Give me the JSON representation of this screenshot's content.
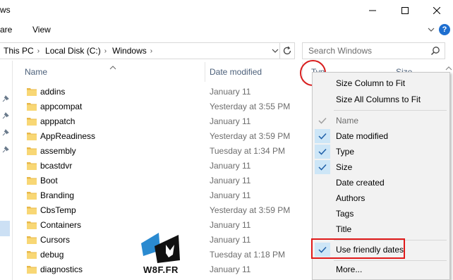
{
  "window": {
    "title": "ws",
    "minimize_icon": "minimize-icon",
    "maximize_icon": "maximize-icon",
    "close_icon": "close-icon"
  },
  "ribbon": {
    "tabs": [
      "are",
      "View"
    ]
  },
  "address": {
    "crumbs": [
      "This PC",
      "Local Disk (C:)",
      "Windows"
    ]
  },
  "search": {
    "placeholder": "Search Windows"
  },
  "columns": {
    "name": "Name",
    "date_modified": "Date modified",
    "type": "Typ",
    "size": "Size"
  },
  "files": [
    {
      "name": "addins",
      "date": "January 11"
    },
    {
      "name": "appcompat",
      "date": "Yesterday at 3:55 PM"
    },
    {
      "name": "apppatch",
      "date": "January 11"
    },
    {
      "name": "AppReadiness",
      "date": "Yesterday at 3:59 PM"
    },
    {
      "name": "assembly",
      "date": "Tuesday at 1:34 PM"
    },
    {
      "name": "bcastdvr",
      "date": "January 11"
    },
    {
      "name": "Boot",
      "date": "January 11"
    },
    {
      "name": "Branding",
      "date": "January 11"
    },
    {
      "name": "CbsTemp",
      "date": "Yesterday at 3:59 PM"
    },
    {
      "name": "Containers",
      "date": "January 11"
    },
    {
      "name": "Cursors",
      "date": "January 11"
    },
    {
      "name": "debug",
      "date": "Tuesday at 1:18 PM"
    },
    {
      "name": "diagnostics",
      "date": "January 11"
    }
  ],
  "context_menu": {
    "size_column_to_fit": "Size Column to Fit",
    "size_all_columns_to_fit": "Size All Columns to Fit",
    "items": [
      {
        "label": "Name",
        "checked": true,
        "disabled": true
      },
      {
        "label": "Date modified",
        "checked": true,
        "disabled": false
      },
      {
        "label": "Type",
        "checked": true,
        "disabled": false
      },
      {
        "label": "Size",
        "checked": true,
        "disabled": false
      },
      {
        "label": "Date created",
        "checked": false,
        "disabled": false
      },
      {
        "label": "Authors",
        "checked": false,
        "disabled": false
      },
      {
        "label": "Tags",
        "checked": false,
        "disabled": false
      },
      {
        "label": "Title",
        "checked": false,
        "disabled": false
      }
    ],
    "use_friendly_dates": "Use friendly dates",
    "more": "More..."
  },
  "watermark": {
    "text": "W8F.FR"
  },
  "colors": {
    "accent": "#0078d7",
    "check_bg": "#cde6f7",
    "highlight_red": "#e01a1a",
    "folder_yellow": "#f8d775"
  }
}
